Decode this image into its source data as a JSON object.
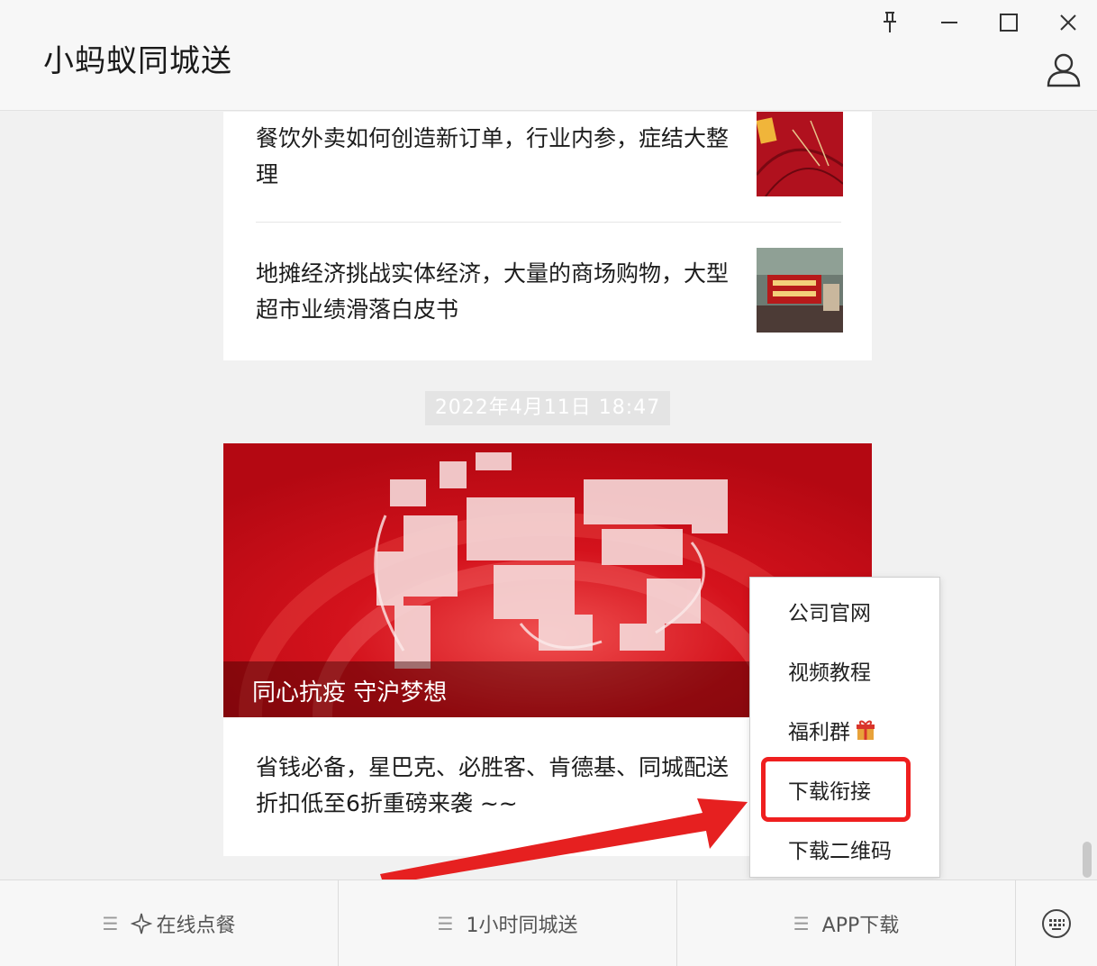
{
  "window": {
    "title": "小蚂蚁同城送",
    "controls": [
      "pin-icon",
      "minimize-icon",
      "maximize-icon",
      "close-icon"
    ],
    "profile_icon": "person-icon"
  },
  "chat": {
    "articles_top": [
      {
        "title": "餐饮外卖如何创造新订单，行业内参，症结大整理"
      },
      {
        "title": "地摊经济挑战实体经济，大量的商场购物，大型超市业绩滑落白皮书"
      }
    ],
    "timestamp": "2022年4月11日  18:47",
    "feature": {
      "cover_caption": "同心抗疫 守沪梦想",
      "description": "省钱必备，星巴克、必胜客、肯德基、同城配送折扣低至6折重磅来袭 ~~"
    }
  },
  "popup_menu": {
    "items": [
      {
        "label": "公司官网"
      },
      {
        "label": "视频教程"
      },
      {
        "label": "福利群",
        "icon": "gift-icon"
      },
      {
        "label": "下载衔接",
        "highlighted": true
      },
      {
        "label": "下载二维码"
      }
    ]
  },
  "bottom_menu": {
    "items": [
      {
        "label": "在线点餐",
        "icon": "sparkle-icon"
      },
      {
        "label": "1小时同城送"
      },
      {
        "label": "APP下载"
      }
    ],
    "keyboard_icon": "keyboard-icon"
  },
  "colors": {
    "accent_red": "#ef1f1f",
    "cover_red": "#d0101a",
    "timestamp_bg": "#e4e4e4"
  }
}
